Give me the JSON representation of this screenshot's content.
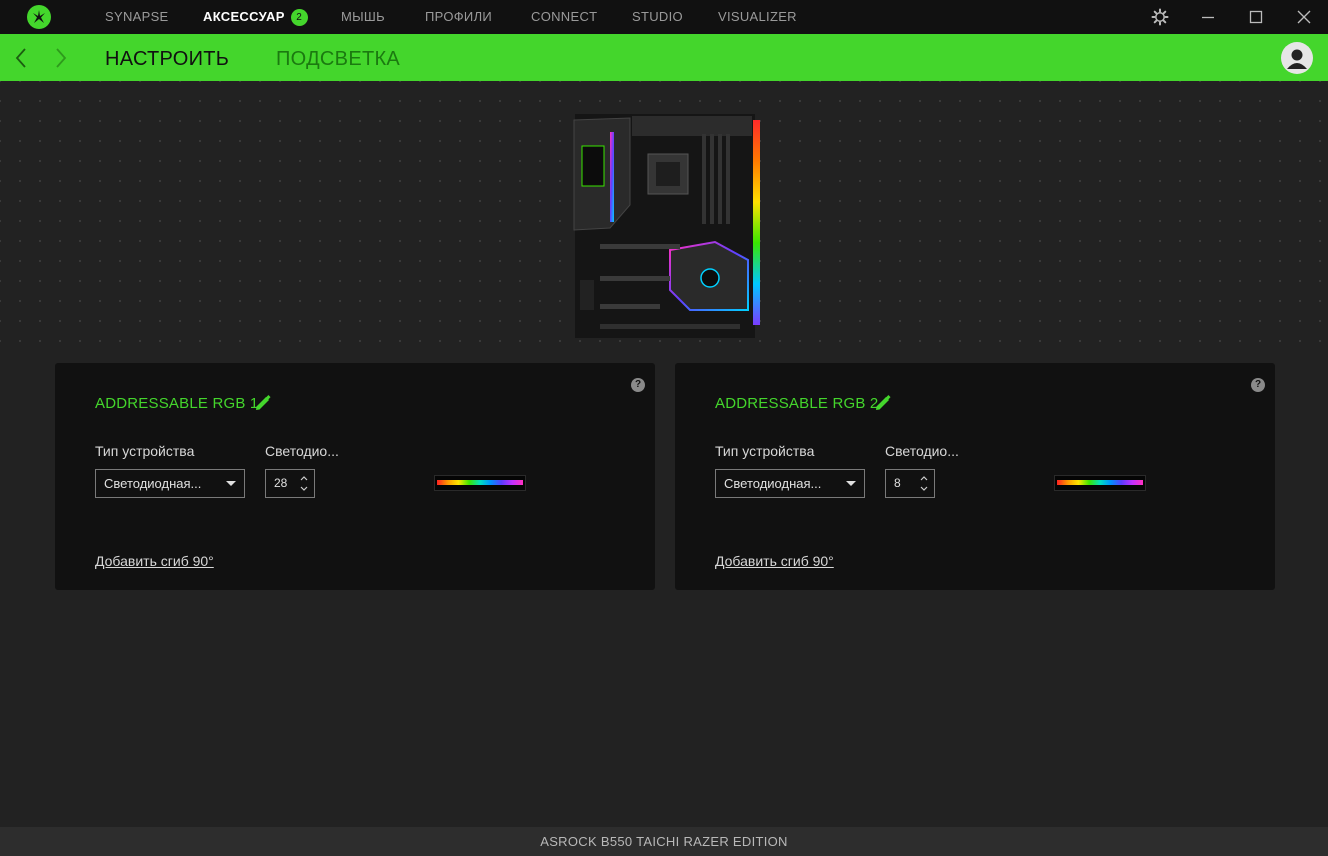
{
  "topbar": {
    "tabs": [
      {
        "label": "SYNAPSE"
      },
      {
        "label": "АКСЕССУАР",
        "badge": "2"
      },
      {
        "label": "МЫШЬ"
      },
      {
        "label": "ПРОФИЛИ"
      },
      {
        "label": "CONNECT"
      },
      {
        "label": "STUDIO"
      },
      {
        "label": "VISUALIZER"
      }
    ]
  },
  "subnav": {
    "tabs": [
      {
        "label": "НАСТРОИТЬ"
      },
      {
        "label": "ПОДСВЕТКА"
      }
    ]
  },
  "cards": [
    {
      "title": "ADDRESSABLE RGB 1",
      "device_type_label": "Тип устройства",
      "device_type_value": "Светодиодная...",
      "led_label": "Светодио...",
      "led_count": "28",
      "add_bend_link": "Добавить сгиб 90°",
      "help": "?"
    },
    {
      "title": "ADDRESSABLE RGB 2",
      "device_type_label": "Тип устройства",
      "device_type_value": "Светодиодная...",
      "led_label": "Светодио...",
      "led_count": "8",
      "add_bend_link": "Добавить сгиб 90°",
      "help": "?"
    }
  ],
  "footer": {
    "device_name": "ASROCK B550 TAICHI RAZER EDITION"
  },
  "colors": {
    "accent": "#44d62c",
    "topbar_bg": "#111111",
    "content_bg": "#222222",
    "card_bg": "#111111"
  }
}
